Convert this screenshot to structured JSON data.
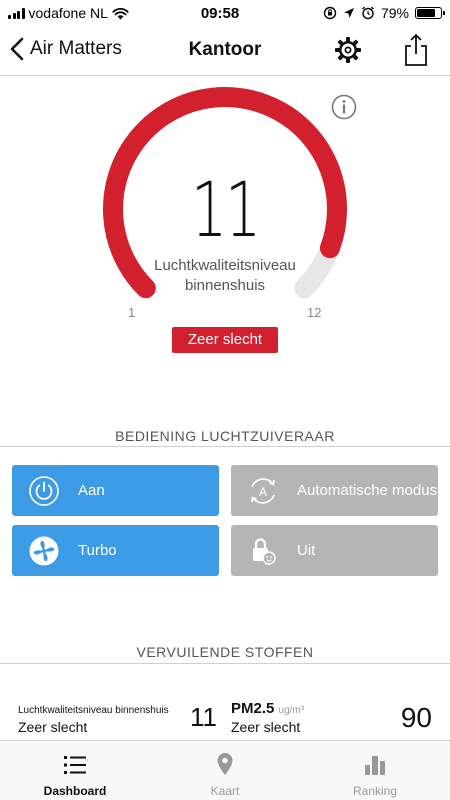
{
  "status_bar": {
    "carrier": "vodafone NL",
    "time": "09:58",
    "battery": "79%",
    "battery_level": 0.79
  },
  "nav": {
    "back_label": "Air Matters",
    "title": "Kantoor"
  },
  "gauge": {
    "value": "11",
    "label_line1": "Luchtkwaliteitsniveau",
    "label_line2": "binnenshuis",
    "min": "1",
    "max": "12",
    "status": "Zeer slecht",
    "level": 11,
    "range": [
      1,
      12
    ],
    "color": "#d2202f"
  },
  "controls": {
    "title": "BEDIENING LUCHTZUIVERAAR",
    "buttons": [
      {
        "label": "Aan",
        "icon": "power-icon",
        "state": "active",
        "color": "#3d9be6"
      },
      {
        "label": "Automatische modus",
        "icon": "auto-mode-icon",
        "state": "inactive",
        "color": "#b5b5b5"
      },
      {
        "label": "Turbo",
        "icon": "fan-icon",
        "state": "active",
        "color": "#3d9be6"
      },
      {
        "label": "Uit",
        "icon": "child-lock-icon",
        "state": "inactive",
        "color": "#b5b5b5"
      }
    ]
  },
  "pollutants": {
    "title": "VERVUILENDE STOFFEN",
    "indoor": {
      "label": "Luchtkwaliteitsniveau binnenshuis",
      "status": "Zeer slecht",
      "value": "11"
    },
    "pm25": {
      "name": "PM2.5",
      "unit": "ug/m³",
      "status": "Zeer slecht",
      "value": "90"
    }
  },
  "tabs": [
    {
      "label": "Dashboard",
      "icon": "list-icon",
      "active": true
    },
    {
      "label": "Kaart",
      "icon": "map-pin-icon",
      "active": false
    },
    {
      "label": "Ranking",
      "icon": "bar-chart-icon",
      "active": false
    }
  ]
}
